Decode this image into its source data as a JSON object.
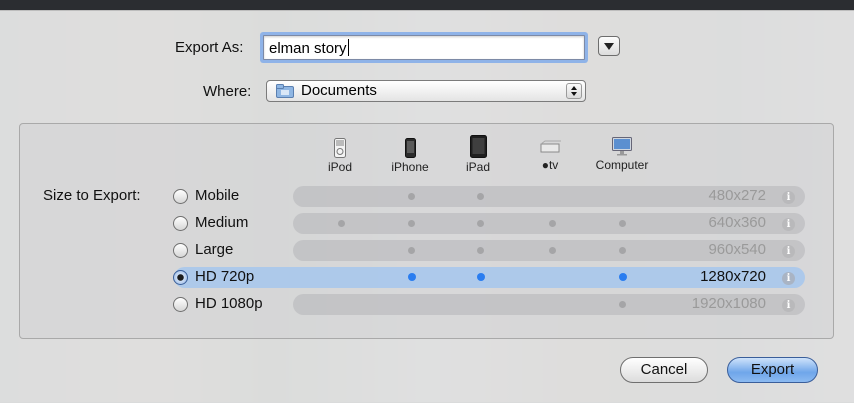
{
  "form": {
    "export_as_label": "Export As:",
    "export_as_value": "elman story",
    "where_label": "Where:",
    "where_value": "Documents",
    "size_label": "Size to Export:"
  },
  "devices": [
    {
      "label": "iPod",
      "icon": "ipod-icon"
    },
    {
      "label": "iPhone",
      "icon": "iphone-icon"
    },
    {
      "label": "iPad",
      "icon": "ipad-icon"
    },
    {
      "label": "\u0000tv",
      "icon": "appletv-icon"
    },
    {
      "label": "Computer",
      "icon": "computer-icon"
    }
  ],
  "sizes": [
    {
      "label": "Mobile",
      "resolution": "480x272",
      "selected": false,
      "dots": [
        false,
        true,
        true,
        false,
        false
      ]
    },
    {
      "label": "Medium",
      "resolution": "640x360",
      "selected": false,
      "dots": [
        true,
        true,
        true,
        true,
        true
      ]
    },
    {
      "label": "Large",
      "resolution": "960x540",
      "selected": false,
      "dots": [
        false,
        true,
        true,
        true,
        true
      ]
    },
    {
      "label": "HD 720p",
      "resolution": "1280x720",
      "selected": true,
      "dots": [
        false,
        true,
        true,
        false,
        true
      ]
    },
    {
      "label": "HD 1080p",
      "resolution": "1920x1080",
      "selected": false,
      "dots": [
        false,
        false,
        false,
        false,
        true
      ]
    }
  ],
  "buttons": {
    "cancel": "Cancel",
    "export": "Export"
  },
  "colors": {
    "selection": "#a8c8ec",
    "compatible_dot_selected": "#2a7df0",
    "compatible_dot": "#a5a5a7"
  }
}
